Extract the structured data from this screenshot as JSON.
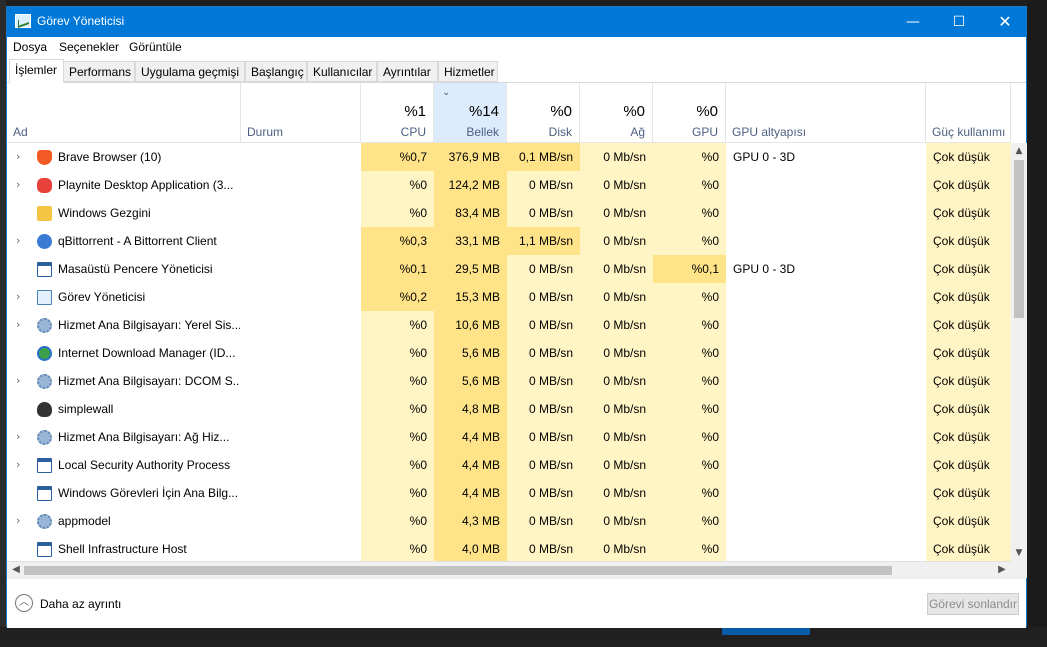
{
  "window": {
    "title": "Görev Yöneticisi"
  },
  "menu": [
    "Dosya",
    "Seçenekler",
    "Görüntüle"
  ],
  "tabs": [
    "İşlemler",
    "Performans",
    "Uygulama geçmişi",
    "Başlangıç",
    "Kullanıcılar",
    "Ayrıntılar",
    "Hizmetler"
  ],
  "columns": {
    "name": "Ad",
    "status": "Durum",
    "cpu": {
      "pct": "%1",
      "label": "CPU"
    },
    "mem": {
      "pct": "%14",
      "label": "Bellek"
    },
    "disk": {
      "pct": "%0",
      "label": "Disk"
    },
    "net": {
      "pct": "%0",
      "label": "Ağ"
    },
    "gpu": {
      "pct": "%0",
      "label": "GPU"
    },
    "gpu_engine": "GPU altyapısı",
    "power": "Güç kullanımı"
  },
  "processes": [
    {
      "name": "Brave Browser (10)",
      "expandable": true,
      "icon": "brave-icon",
      "cpu": "%0,7",
      "mem": "376,9 MB",
      "disk": "0,1 MB/sn",
      "net": "0 Mb/sn",
      "gpu": "%0",
      "gpu_engine": "GPU 0 - 3D",
      "power": "Çok düşük"
    },
    {
      "name": "Playnite Desktop Application (3...",
      "expandable": true,
      "icon": "gamepad-icon",
      "cpu": "%0",
      "mem": "124,2 MB",
      "disk": "0 MB/sn",
      "net": "0 Mb/sn",
      "gpu": "%0",
      "gpu_engine": "",
      "power": "Çok düşük"
    },
    {
      "name": "Windows Gezgini",
      "expandable": false,
      "icon": "folder-icon",
      "cpu": "%0",
      "mem": "83,4 MB",
      "disk": "0 MB/sn",
      "net": "0 Mb/sn",
      "gpu": "%0",
      "gpu_engine": "",
      "power": "Çok düşük"
    },
    {
      "name": "qBittorrent - A Bittorrent Client",
      "expandable": true,
      "icon": "qbittorrent-icon",
      "cpu": "%0,3",
      "mem": "33,1 MB",
      "disk": "1,1 MB/sn",
      "net": "0 Mb/sn",
      "gpu": "%0",
      "gpu_engine": "",
      "power": "Çok düşük"
    },
    {
      "name": "Masaüstü Pencere Yöneticisi",
      "expandable": false,
      "icon": "window-icon",
      "cpu": "%0,1",
      "mem": "29,5 MB",
      "disk": "0 MB/sn",
      "net": "0 Mb/sn",
      "gpu": "%0,1",
      "gpu_engine": "GPU 0 - 3D",
      "power": "Çok düşük"
    },
    {
      "name": "Görev Yöneticisi",
      "expandable": true,
      "icon": "task-manager-icon",
      "cpu": "%0,2",
      "mem": "15,3 MB",
      "disk": "0 MB/sn",
      "net": "0 Mb/sn",
      "gpu": "%0",
      "gpu_engine": "",
      "power": "Çok düşük"
    },
    {
      "name": "Hizmet Ana Bilgisayarı: Yerel Sis...",
      "expandable": true,
      "icon": "gear-icon",
      "cpu": "%0",
      "mem": "10,6 MB",
      "disk": "0 MB/sn",
      "net": "0 Mb/sn",
      "gpu": "%0",
      "gpu_engine": "",
      "power": "Çok düşük"
    },
    {
      "name": "Internet Download Manager (ID...",
      "expandable": false,
      "icon": "globe-download-icon",
      "cpu": "%0",
      "mem": "5,6 MB",
      "disk": "0 MB/sn",
      "net": "0 Mb/sn",
      "gpu": "%0",
      "gpu_engine": "",
      "power": "Çok düşük"
    },
    {
      "name": "Hizmet Ana Bilgisayarı: DCOM S...",
      "expandable": true,
      "icon": "gear-icon",
      "cpu": "%0",
      "mem": "5,6 MB",
      "disk": "0 MB/sn",
      "net": "0 Mb/sn",
      "gpu": "%0",
      "gpu_engine": "",
      "power": "Çok düşük"
    },
    {
      "name": "simplewall",
      "expandable": false,
      "icon": "flame-icon",
      "cpu": "%0",
      "mem": "4,8 MB",
      "disk": "0 MB/sn",
      "net": "0 Mb/sn",
      "gpu": "%0",
      "gpu_engine": "",
      "power": "Çok düşük"
    },
    {
      "name": "Hizmet Ana Bilgisayarı: Ağ Hiz...",
      "expandable": true,
      "icon": "gear-icon",
      "cpu": "%0",
      "mem": "4,4 MB",
      "disk": "0 MB/sn",
      "net": "0 Mb/sn",
      "gpu": "%0",
      "gpu_engine": "",
      "power": "Çok düşük"
    },
    {
      "name": "Local Security Authority Process",
      "expandable": true,
      "icon": "window-icon",
      "cpu": "%0",
      "mem": "4,4 MB",
      "disk": "0 MB/sn",
      "net": "0 Mb/sn",
      "gpu": "%0",
      "gpu_engine": "",
      "power": "Çok düşük"
    },
    {
      "name": "Windows Görevleri İçin Ana Bilg...",
      "expandable": false,
      "icon": "window-icon",
      "cpu": "%0",
      "mem": "4,4 MB",
      "disk": "0 MB/sn",
      "net": "0 Mb/sn",
      "gpu": "%0",
      "gpu_engine": "",
      "power": "Çok düşük"
    },
    {
      "name": "appmodel",
      "expandable": true,
      "icon": "gear-icon",
      "cpu": "%0",
      "mem": "4,3 MB",
      "disk": "0 MB/sn",
      "net": "0 Mb/sn",
      "gpu": "%0",
      "gpu_engine": "",
      "power": "Çok düşük"
    },
    {
      "name": "Shell Infrastructure Host",
      "expandable": false,
      "icon": "window-icon",
      "cpu": "%0",
      "mem": "4,0 MB",
      "disk": "0 MB/sn",
      "net": "0 Mb/sn",
      "gpu": "%0",
      "gpu_engine": "",
      "power": "Çok düşük"
    }
  ],
  "footer": {
    "less_details": "Daha az ayrıntı",
    "end_task": "Görevi sonlandır"
  },
  "colors": {
    "titlebar": "#0078d7",
    "heat_light": "#fff4c4",
    "heat_mid": "#ffeda8",
    "heat_strong": "#ffe389",
    "sorted_header": "#dcecfc"
  }
}
